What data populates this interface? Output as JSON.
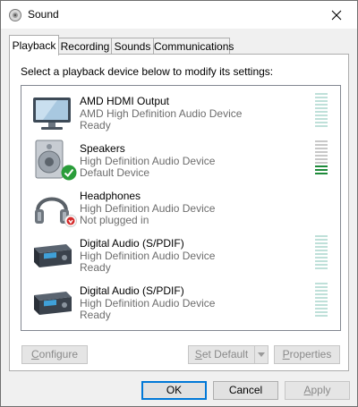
{
  "window": {
    "title": "Sound"
  },
  "tabs": [
    {
      "label": "Playback",
      "active": true
    },
    {
      "label": "Recording",
      "active": false
    },
    {
      "label": "Sounds",
      "active": false
    },
    {
      "label": "Communications",
      "active": false
    }
  ],
  "panel": {
    "instructions": "Select a playback device below to modify its settings:"
  },
  "devices": [
    {
      "name": "AMD HDMI Output",
      "description": "AMD High Definition Audio Device",
      "status": "Ready",
      "icon": "monitor-icon",
      "level": 0
    },
    {
      "name": "Speakers",
      "description": "High Definition Audio Device",
      "status": "Default Device",
      "icon": "speaker-icon",
      "badge": "default-check-icon",
      "level": 0.3
    },
    {
      "name": "Headphones",
      "description": "High Definition Audio Device",
      "status": "Not plugged in",
      "icon": "headphones-icon",
      "badge": "unplugged-icon",
      "level": 0
    },
    {
      "name": "Digital Audio (S/PDIF)",
      "description": "High Definition Audio Device",
      "status": "Ready",
      "icon": "digital-receiver-icon",
      "level": 0
    },
    {
      "name": "Digital Audio (S/PDIF)",
      "description": "High Definition Audio Device",
      "status": "Ready",
      "icon": "digital-receiver-icon",
      "level": 0
    }
  ],
  "panel_buttons": {
    "configure": {
      "label_ul": "C",
      "label_rest": "onfigure",
      "enabled": false
    },
    "set_default": {
      "label_ul": "S",
      "label_rest": "et Default",
      "enabled": false
    },
    "properties": {
      "label_ul": "P",
      "label_rest": "roperties",
      "enabled": false
    }
  },
  "dialog_buttons": {
    "ok": "OK",
    "cancel": "Cancel",
    "apply_ul": "A",
    "apply_rest": "pply"
  },
  "colors": {
    "accent": "#0078d7",
    "meter_idle": "#bfe0d9",
    "meter_lit": "#1e8a3a",
    "check_badge": "#2a9d3a",
    "unplug_badge": "#d42a2a"
  }
}
